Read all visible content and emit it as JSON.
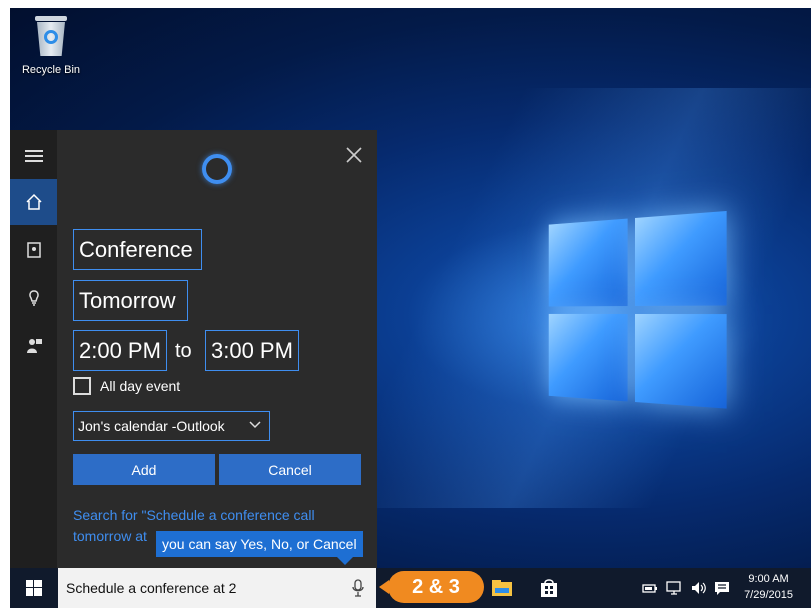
{
  "desktop": {
    "recycle_bin_label": "Recycle Bin"
  },
  "cortana": {
    "rail": {
      "items": [
        {
          "icon": "hamburger-menu-icon"
        },
        {
          "icon": "home-icon",
          "active": true
        },
        {
          "icon": "notebook-icon"
        },
        {
          "icon": "lightbulb-icon"
        },
        {
          "icon": "feedback-icon"
        }
      ]
    },
    "event": {
      "title": "Conference",
      "date": "Tomorrow",
      "start_time": "2:00 PM",
      "to_label": "to",
      "end_time": "3:00 PM",
      "all_day_label": "All day event",
      "all_day_checked": false,
      "calendar": "Jon's calendar -Outlook",
      "add_label": "Add",
      "cancel_label": "Cancel"
    },
    "search_link": "Search for \"Schedule a conference call tomorrow at",
    "tooltip": "you can say Yes, No, or Cancel"
  },
  "taskbar": {
    "search_text": "Schedule a conference at 2",
    "callout": "2 & 3",
    "clock_time": "9:00 AM",
    "clock_date": "7/29/2015"
  },
  "colors": {
    "accent": "#3f8ef0",
    "button": "#2d6dc7",
    "callout": "#f08a20",
    "panel": "#2b2b2b"
  }
}
